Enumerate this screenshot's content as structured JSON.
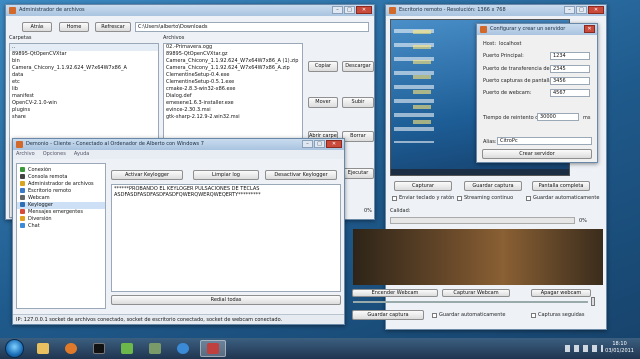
{
  "file_admin": {
    "title": "Administrador de archivos",
    "buttons": {
      "back": "Atrás",
      "home": "Home",
      "refresh": "Refrescar",
      "copy": "Copiar",
      "download": "Descargar",
      "move": "Mover",
      "upload": "Subir",
      "open_folder": "Abrir carpeta",
      "delete": "Borrar",
      "execute": "Ejecutar"
    },
    "path": "C:\\Users\\alberto\\Downloads",
    "folders_label": "Carpetas",
    "files_label": "Archivos",
    "folders": [
      "..",
      "89895-QtOpenCVXtar",
      "bin",
      "Camera_Chicony_1.1.92.624_W7x64W7x86_A",
      "data",
      "etc",
      "lib",
      "manifest",
      "OpenCV-2.1.0-win",
      "plugins",
      "share"
    ],
    "files": [
      "02.-Primavera.ogg",
      "89895-QtOpenCVXtar.gz",
      "Camera_Chicony_1.1.92.624_W7x64W7x86_A (1).zip",
      "Camera_Chicony_1.1.92.624_W7x64W7x86_A.zip",
      "ClementineSetup-0.4.exe",
      "ClementineSetup-0.5.1.exe",
      "cmake-2.8.3-win32-x86.exe",
      "Dialog.def",
      "emesene1.6.3-installer.exe",
      "evince-2.30.3.msi",
      "gtk-sharp-2.12.9-2.win32.msi"
    ]
  },
  "remote_desktop": {
    "title": "Escritorio remoto - Resolución: 1366 x 768",
    "buttons": {
      "capture": "Capturar",
      "save_capture": "Guardar captura",
      "fullscreen": "Pantalla completa",
      "start_webcam": "Encender Webcam",
      "capture_webcam": "Capturar Webcam",
      "stop_webcam": "Apagar webcam",
      "save_webcam": "Guardar captura"
    },
    "checkboxes": {
      "send_keys": "Enviar teclado y ratón",
      "streaming": "Streaming continuo",
      "auto_save": "Guardar automaticamente",
      "auto_save_webcam": "Guardar automaticamente",
      "secure_captures": "Capturas seguidas"
    },
    "quality_label": "Calidad:",
    "quality_value": "0%",
    "progress_value": "0%",
    "webcam_progress": "0%"
  },
  "server_config": {
    "title": "Configurar y crear un servidor",
    "host_label": "Host:",
    "host_value": "localhost",
    "main_port_label": "Puerto Principal:",
    "main_port_value": "1234",
    "file_port_label": "Puerto de transferencia de archivos:",
    "file_port_value": "2345",
    "screen_port_label": "Puerto capturas de pantalla:",
    "screen_port_value": "3456",
    "webcam_port_label": "Puerto de webcam:",
    "webcam_port_value": "4567",
    "timeout_label": "Tiempo de reintento de conexión:",
    "timeout_value": "30000",
    "timeout_unit": "ms",
    "alias_label": "Alias:",
    "alias_value": "CitroPc",
    "create_button": "Crear servidor"
  },
  "client": {
    "title": "Demonio - Cliente - Conectado al Ordenador de Alberto con Windows 7",
    "menu": [
      "Archivo",
      "Opciones",
      "Ayuda"
    ],
    "tree": [
      {
        "label": "Conexión",
        "color": "#3a9a3a"
      },
      {
        "label": "Consola remota",
        "color": "#444444"
      },
      {
        "label": "Administrador de archivos",
        "color": "#d9a520"
      },
      {
        "label": "Escritorio remoto",
        "color": "#3a7ac8"
      },
      {
        "label": "Webcam",
        "color": "#666666"
      },
      {
        "label": "Keylogger",
        "color": "#2f6db5"
      },
      {
        "label": "Mensajes emergentes",
        "color": "#d94a3a"
      },
      {
        "label": "Diversión",
        "color": "#e0a020"
      },
      {
        "label": "Chat",
        "color": "#3a8ad8"
      }
    ],
    "keylogger_buttons": {
      "activate": "Activar Keylogger",
      "clear": "Limpiar log",
      "deactivate": "Desactivar Keylogger"
    },
    "log_line1": "******PROBANDO EL KEYLOGER PULSACIONES DE TECLAS",
    "log_line2": "ASDFASDFASDFASDFASDFQWERQWERQWEQERTY*********",
    "redial_button": "Redial todas",
    "status": "IP: 127.0.0.1 socket de archivos conectado, socket de escritorio conectado, socket de webcam conectado."
  },
  "taskbar": {
    "clock_time": "18:10",
    "clock_date": "03/01/2011"
  }
}
